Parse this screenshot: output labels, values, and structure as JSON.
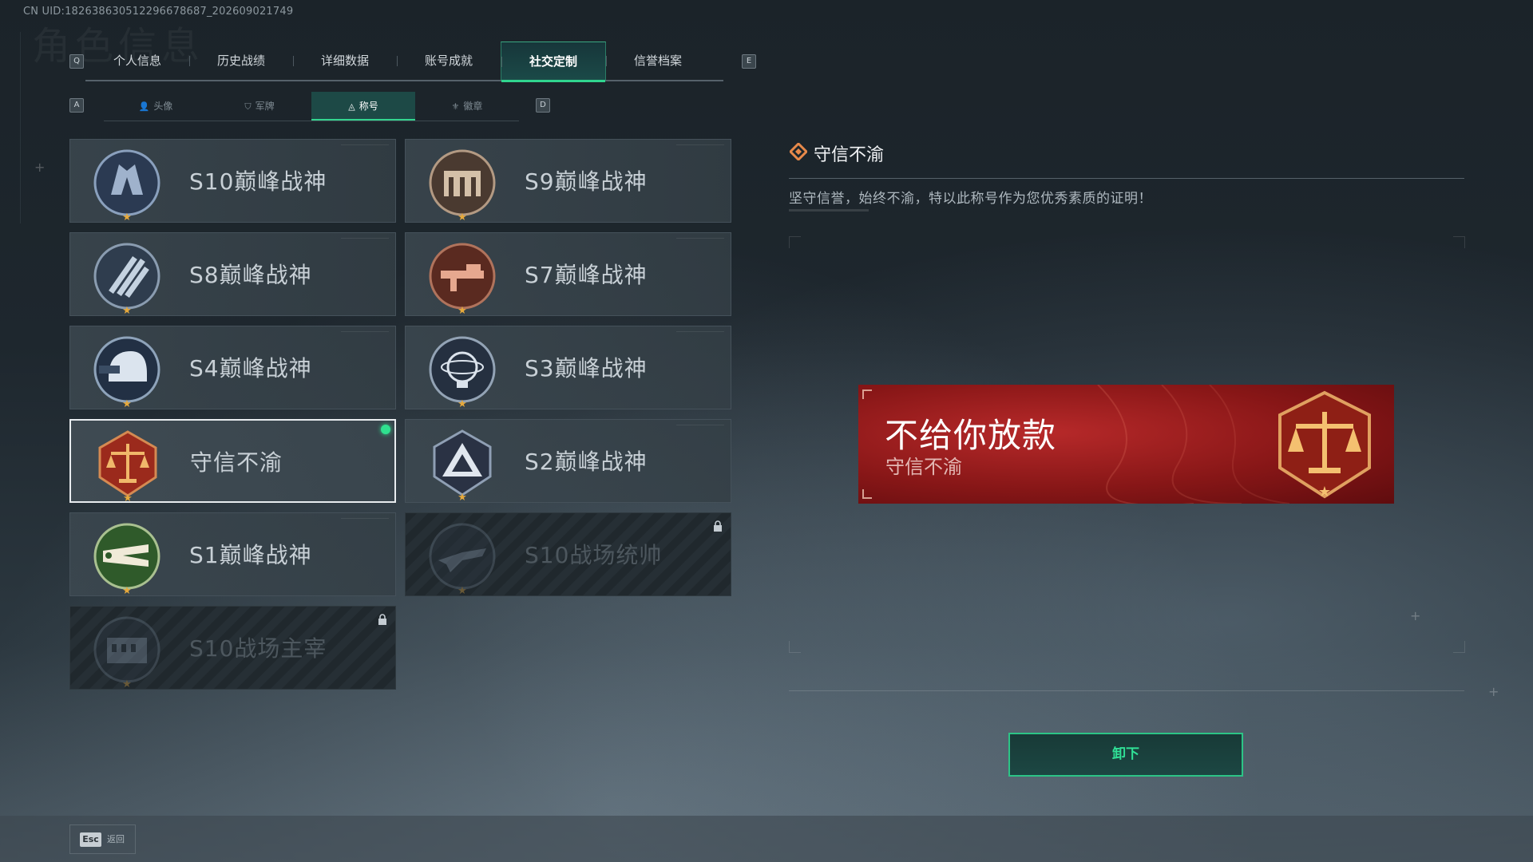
{
  "uid_text": "CN UID:1826386305122966786​87_202609021749",
  "background_title": "角色信息",
  "keys": {
    "prev_tab": "Q",
    "next_tab": "E",
    "prev_sub": "A",
    "next_sub": "D"
  },
  "tabs": [
    {
      "label": "个人信息",
      "active": false
    },
    {
      "label": "历史战绩",
      "active": false
    },
    {
      "label": "详细数据",
      "active": false
    },
    {
      "label": "账号成就",
      "active": false
    },
    {
      "label": "社交定制",
      "active": true
    },
    {
      "label": "信誉档案",
      "active": false
    }
  ],
  "subtabs": [
    {
      "label": "头像",
      "icon": "person-icon",
      "active": false
    },
    {
      "label": "军牌",
      "icon": "dogtag-icon",
      "active": false
    },
    {
      "label": "称号",
      "icon": "title-icon",
      "active": true
    },
    {
      "label": "徽章",
      "icon": "badge-icon",
      "active": false
    }
  ],
  "titles": [
    {
      "name": "S10巅峰战神",
      "emblem": "castle-emblem-icon",
      "locked": false,
      "selected": false
    },
    {
      "name": "S9巅峰战神",
      "emblem": "fortress-emblem-icon",
      "locked": false,
      "selected": false
    },
    {
      "name": "S8巅峰战神",
      "emblem": "slash-emblem-icon",
      "locked": false,
      "selected": false
    },
    {
      "name": "S7巅峰战神",
      "emblem": "rifle-emblem-icon",
      "locked": false,
      "selected": false
    },
    {
      "name": "S4巅峰战神",
      "emblem": "helmet-emblem-icon",
      "locked": false,
      "selected": false
    },
    {
      "name": "S3巅峰战神",
      "emblem": "globe-emblem-icon",
      "locked": false,
      "selected": false
    },
    {
      "name": "守信不渝",
      "emblem": "scales-emblem-icon",
      "locked": false,
      "selected": true
    },
    {
      "name": "S2巅峰战神",
      "emblem": "triangle-emblem-icon",
      "locked": false,
      "selected": false
    },
    {
      "name": "S1巅峰战神",
      "emblem": "crocodile-emblem-icon",
      "locked": false,
      "selected": false
    },
    {
      "name": "S10战场统帅",
      "emblem": "aircraft-emblem-icon",
      "locked": true,
      "selected": false
    },
    {
      "name": "S10战场主宰",
      "emblem": "colosseum-emblem-icon",
      "locked": true,
      "selected": false
    }
  ],
  "detail": {
    "title": "守信不渝",
    "description": "坚守信誉，始终不渝，特以此称号作为您优秀素质的证明！"
  },
  "banner": {
    "player_name": "不给你放款",
    "title": "守信不渝"
  },
  "actions": {
    "unequip": "卸下"
  },
  "footer": {
    "esc_key": "Esc",
    "esc_label": "返回"
  },
  "colors": {
    "accent": "#30d58f",
    "banner_red": "#b02226",
    "star": "#e6a93c"
  }
}
